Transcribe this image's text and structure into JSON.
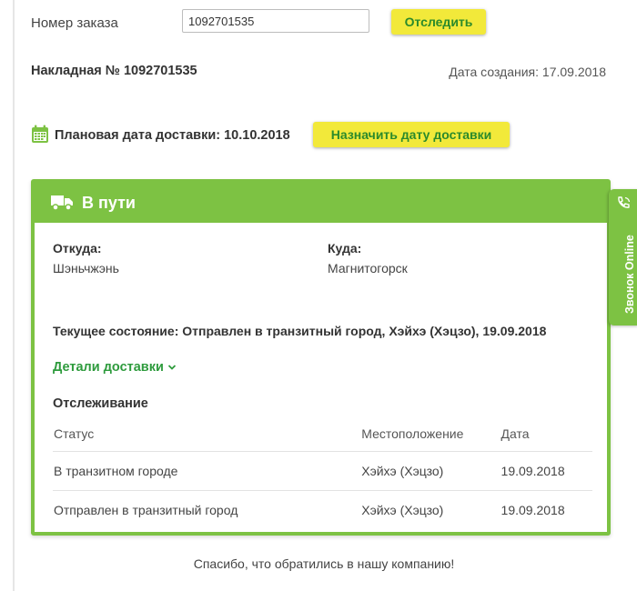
{
  "order": {
    "label": "Номер заказа",
    "value": "1092701535",
    "track_button": "Отследить"
  },
  "waybill": {
    "title": "Накладная № 1092701535",
    "created": "Дата создания: 17.09.2018"
  },
  "planned": {
    "text": "Плановая дата доставки: 10.10.2018",
    "schedule_button": "Назначить дату доставки"
  },
  "card": {
    "status": "В пути",
    "from_label": "Откуда:",
    "from_value": "Шэньчжэнь",
    "to_label": "Куда:",
    "to_value": "Магнитогорск",
    "current": "Текущее состояние: Отправлен в транзитный город, Хэйхэ (Хэцзо), 19.09.2018",
    "details_link": "Детали доставки",
    "tracking_title": "Отслеживание",
    "columns": [
      "Статус",
      "Местоположение",
      "Дата"
    ],
    "rows": [
      [
        "В транзитном городе",
        "Хэйхэ (Хэцзо)",
        "19.09.2018"
      ],
      [
        "Отправлен в транзитный город",
        "Хэйхэ (Хэцзо)",
        "19.09.2018"
      ]
    ]
  },
  "footer": {
    "thanks": "Спасибо, что обратились в нашу компанию!"
  },
  "side_widget": {
    "label": "Звонок Online",
    "icon": "phone-icon"
  },
  "colors": {
    "accent_green": "#7dc243",
    "button_yellow": "#f2e93a",
    "link_green": "#2e9b3d"
  }
}
